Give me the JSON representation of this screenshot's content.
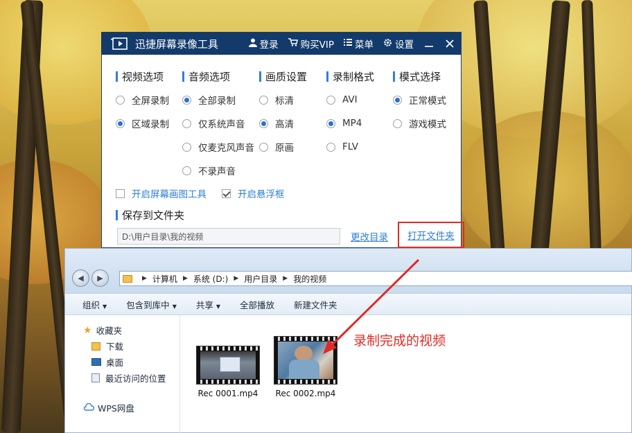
{
  "recorder": {
    "app_name": "迅捷屏幕录像工具",
    "menu": {
      "login": "登录",
      "vip": "购买VIP",
      "menu": "菜单",
      "settings": "设置"
    },
    "columns": [
      {
        "title": "视频选项",
        "options": [
          {
            "label": "全屏录制",
            "selected": false
          },
          {
            "label": "区域录制",
            "selected": true
          }
        ]
      },
      {
        "title": "音频选项",
        "options": [
          {
            "label": "全部录制",
            "selected": true
          },
          {
            "label": "仅系统声音",
            "selected": false
          },
          {
            "label": "仅麦克风声音",
            "selected": false
          },
          {
            "label": "不录声音",
            "selected": false
          }
        ]
      },
      {
        "title": "画质设置",
        "options": [
          {
            "label": "标清",
            "selected": false
          },
          {
            "label": "高清",
            "selected": true
          },
          {
            "label": "原画",
            "selected": false
          }
        ]
      },
      {
        "title": "录制格式",
        "options": [
          {
            "label": "AVI",
            "selected": false
          },
          {
            "label": "MP4",
            "selected": true
          },
          {
            "label": "FLV",
            "selected": false
          }
        ]
      },
      {
        "title": "模式选择",
        "options": [
          {
            "label": "正常模式",
            "selected": true
          },
          {
            "label": "游戏模式",
            "selected": false
          }
        ]
      }
    ],
    "checks": [
      {
        "label": "开启屏幕画图工具",
        "checked": false
      },
      {
        "label": "开启悬浮框",
        "checked": true
      }
    ],
    "save_heading": "保存到文件夹",
    "save_path": "D:\\用户目录\\我的视频",
    "change_dir": "更改目录",
    "open_folder": "打开文件夹"
  },
  "explorer": {
    "breadcrumb": [
      "计算机",
      "系统 (D:)",
      "用户目录",
      "我的视频"
    ],
    "toolbar": {
      "organize": "组织",
      "include_library": "包含到库中",
      "share": "共享",
      "play_all": "全部播放",
      "new_folder": "新建文件夹"
    },
    "sidebar": {
      "favorites": "收藏夹",
      "downloads": "下载",
      "desktop": "桌面",
      "recent": "最近访问的位置",
      "wps": "WPS网盘"
    },
    "files": [
      {
        "name": "Rec 0001.mp4"
      },
      {
        "name": "Rec 0002.mp4"
      }
    ]
  },
  "annotation": "录制完成的视频",
  "colors": {
    "accent": "#2f7fd6",
    "titlebar": "#123a6b",
    "highlight": "#e12a24"
  }
}
